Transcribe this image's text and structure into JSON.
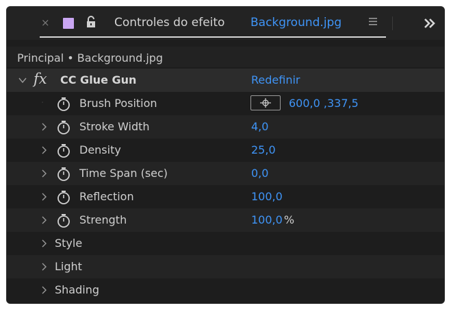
{
  "tab": {
    "close_glyph": "×",
    "title": "Controles do efeito",
    "file": "Background.jpg",
    "swatch_color": "#c9a6f2",
    "icons": [
      "close-icon",
      "lock-icon",
      "menu-icon",
      "overflow-icon"
    ]
  },
  "breadcrumb": "Principal • Background.jpg",
  "effect": {
    "name": "CC Glue Gun",
    "fx_label": "fx",
    "reset_label": "Redefinir"
  },
  "properties": [
    {
      "label": "Brush Position",
      "value_x": "600,0",
      "value_y": "337,5",
      "has_target": true
    },
    {
      "label": "Stroke Width",
      "value": "4,0"
    },
    {
      "label": "Density",
      "value": "25,0"
    },
    {
      "label": "Time Span (sec)",
      "value": "0,0"
    },
    {
      "label": "Reflection",
      "value": "100,0"
    },
    {
      "label": "Strength",
      "value": "100,0",
      "unit": "%"
    }
  ],
  "groups": [
    {
      "label": "Style"
    },
    {
      "label": "Light"
    },
    {
      "label": "Shading"
    }
  ],
  "colors": {
    "accent": "#3f94f6",
    "panel_bg": "#1d1d1d",
    "text": "#cfcfcf"
  }
}
